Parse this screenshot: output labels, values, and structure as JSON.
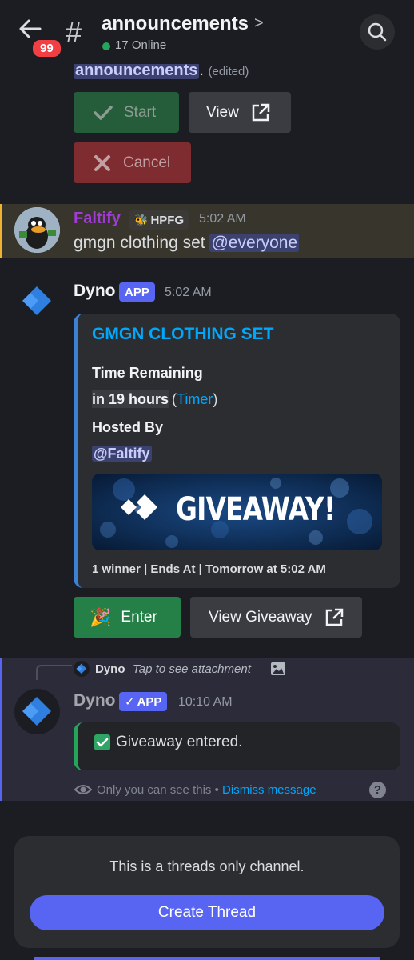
{
  "header": {
    "badge_count": "99",
    "hash": "#",
    "channel_name": "announcements",
    "chevron": ">",
    "online": "17 Online"
  },
  "prev_message": {
    "mention": "announcements",
    "suffix": ".",
    "edited": "(edited)",
    "start_label": "Start",
    "view_label": "View",
    "cancel_label": "Cancel"
  },
  "faltify_message": {
    "author": "Faltify",
    "role_tag": "HPFG",
    "time": "5:02 AM",
    "text": "gmgn clothing set",
    "mention": "@everyone"
  },
  "dyno_message": {
    "author": "Dyno",
    "app_tag": "APP",
    "time": "5:02 AM",
    "embed": {
      "title": "GMGN CLOTHING SET",
      "time_remaining_label": "Time Remaining",
      "time_remaining_value": "in 19 hours",
      "timer_open": "(",
      "timer_link": "Timer",
      "timer_close": ")",
      "hosted_by_label": "Hosted By",
      "host": "@Faltify",
      "banner_text": "GIVEAWAY!",
      "footer": "1 winner | Ends At | Tomorrow at 5:02 AM"
    },
    "enter_label": "Enter",
    "view_giveaway_label": "View Giveaway"
  },
  "ephemeral": {
    "reply_author": "Dyno",
    "reply_text": "Tap to see attachment",
    "author": "Dyno",
    "app_tag": "APP",
    "check": "✓",
    "time": "10:10 AM",
    "message": "Giveaway entered.",
    "only_you": "Only you can see this",
    "dot": "•",
    "dismiss": "Dismiss message",
    "help": "?"
  },
  "bottom": {
    "notice": "This is a threads only channel.",
    "create_thread_label": "Create Thread"
  },
  "colors": {
    "accent": "#5865f2",
    "green": "#248046",
    "link": "#00a8fc",
    "faltify_name": "#a23bd6"
  }
}
